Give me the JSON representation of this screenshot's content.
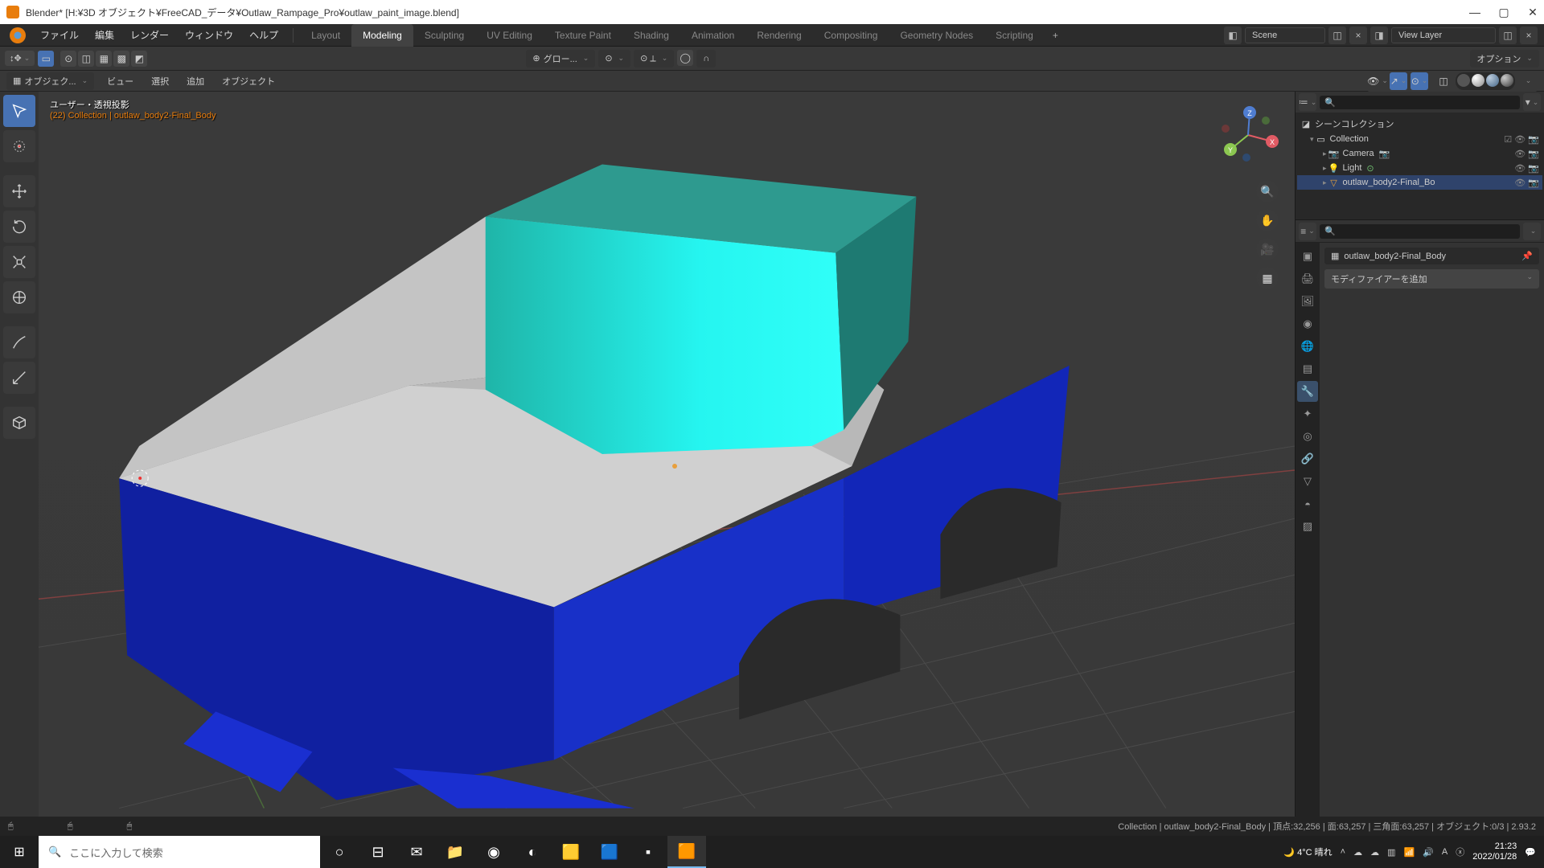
{
  "title": "Blender* [H:¥3D オブジェクト¥FreeCAD_データ¥Outlaw_Rampage_Pro¥outlaw_paint_image.blend]",
  "menu": {
    "file": "ファイル",
    "edit": "編集",
    "render": "レンダー",
    "window": "ウィンドウ",
    "help": "ヘルプ"
  },
  "workspaces": {
    "tabs": [
      "Layout",
      "Modeling",
      "Sculpting",
      "UV Editing",
      "Texture Paint",
      "Shading",
      "Animation",
      "Rendering",
      "Compositing",
      "Geometry Nodes",
      "Scripting"
    ],
    "active": 1
  },
  "scene": {
    "name": "Scene",
    "viewlayer": "View Layer"
  },
  "tool_header": {
    "options": "オプション",
    "transform": "グロー..."
  },
  "obj_header": {
    "mode": "オブジェク...",
    "view": "ビュー",
    "select": "選択",
    "add": "追加",
    "object": "オブジェクト"
  },
  "viewport": {
    "line1": "ユーザー・透視投影",
    "line2": "(22) Collection | outlaw_body2-Final_Body"
  },
  "outliner": {
    "title": "シーンコレクション",
    "collection": "Collection",
    "items": [
      {
        "name": "Camera"
      },
      {
        "name": "Light"
      },
      {
        "name": "outlaw_body2-Final_Bo"
      }
    ]
  },
  "properties": {
    "obj": "outlaw_body2-Final_Body",
    "add_modifier": "モディファイアーを追加"
  },
  "status": {
    "left_icons": "",
    "text": "Collection | outlaw_body2-Final_Body | 頂点:32,256 | 面:63,257 | 三角面:63,257 | オブジェクト:0/3 | 2.93.2"
  },
  "taskbar": {
    "search": "ここに入力して検索",
    "weather": "4°C 晴れ",
    "time": "21:23",
    "date": "2022/01/28"
  }
}
